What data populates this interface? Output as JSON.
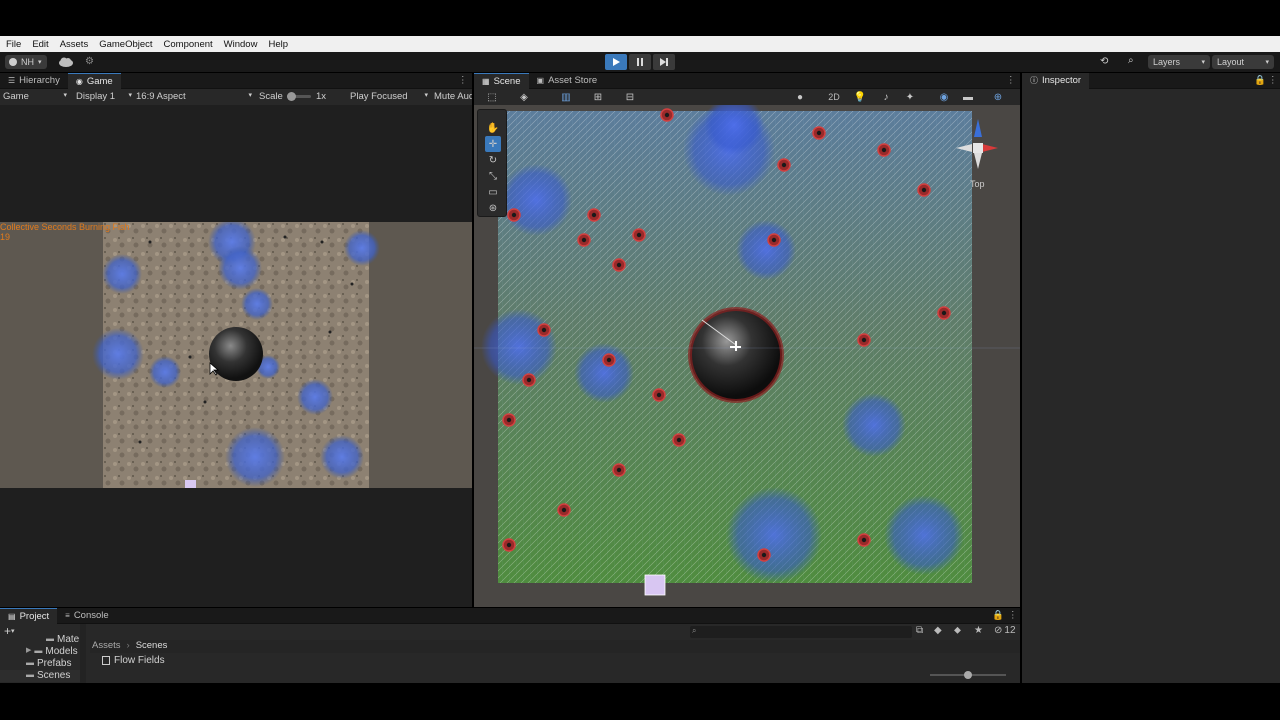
{
  "menu": [
    "File",
    "Edit",
    "Assets",
    "GameObject",
    "Component",
    "Window",
    "Help"
  ],
  "toolbar": {
    "account": "NH",
    "layers": "Layers",
    "layout": "Layout"
  },
  "hierarchy_tab": "Hierarchy",
  "game": {
    "tab": "Game",
    "mode": "Game",
    "display": "Display 1",
    "aspect": "16:9 Aspect",
    "scale_label": "Scale",
    "scale_value": "1x",
    "play_focused": "Play Focused",
    "mute": "Mute Audio",
    "overlay_title": "Collective Seconds Burning Fish",
    "overlay_value": "19"
  },
  "scene": {
    "tab": "Scene",
    "asset_store_tab": "Asset Store",
    "view_2d": "2D",
    "gizmo_label": "Top"
  },
  "inspector_tab": "Inspector",
  "project": {
    "tab": "Project",
    "console_tab": "Console",
    "tree": [
      "Mate",
      "Models",
      "Prefabs",
      "Scenes"
    ],
    "breadcrumb": [
      "Assets",
      "Scenes"
    ],
    "files": [
      "Flow Fields"
    ],
    "hidden_count": "12"
  },
  "colors": {
    "accent": "#3a79bb",
    "overlay_text": "#e07a1c",
    "panel": "#282828",
    "header": "#191919"
  }
}
